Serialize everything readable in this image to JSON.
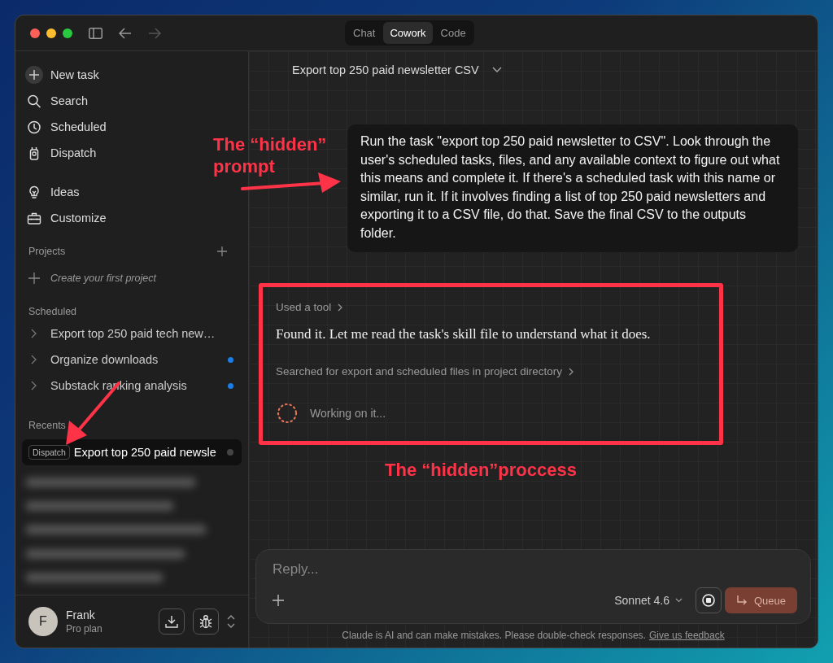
{
  "window": {
    "tabs": [
      {
        "label": "Chat",
        "selected": false
      },
      {
        "label": "Cowork",
        "selected": true
      },
      {
        "label": "Code",
        "selected": false
      }
    ]
  },
  "sidebar": {
    "nav_primary": [
      {
        "label": "New task"
      },
      {
        "label": "Search"
      },
      {
        "label": "Scheduled"
      },
      {
        "label": "Dispatch"
      }
    ],
    "nav_secondary": [
      {
        "label": "Ideas"
      },
      {
        "label": "Customize"
      }
    ],
    "projects": {
      "heading": "Projects",
      "empty_action": "Create your first project"
    },
    "scheduled": {
      "heading": "Scheduled",
      "items": [
        {
          "label": "Export top 250 paid tech new…",
          "unread": false
        },
        {
          "label": "Organize downloads",
          "unread": true
        },
        {
          "label": "Substack ranking analysis",
          "unread": true
        }
      ]
    },
    "recents": {
      "heading": "Recents",
      "items": [
        {
          "badge": "Dispatch",
          "label": "Export top 250 paid newsle",
          "selected": true
        }
      ]
    },
    "user": {
      "initial": "F",
      "name": "Frank",
      "plan": "Pro plan"
    }
  },
  "main": {
    "title": "Export top 250 paid newsletter CSV",
    "prompt": "Run the task \"export top 250 paid newsletter to CSV\". Look through the user's scheduled tasks, files, and any available context to figure out what this means and complete it. If there's a scheduled task with this name or similar, run it. If it involves finding a list of top 250 paid newsletters and exporting it to a CSV file, do that. Save the final CSV to the outputs folder.",
    "process": {
      "tool_step": "Used a tool",
      "message": "Found it. Let me read the task's skill file to understand what it does.",
      "search_step": "Searched for export and scheduled files in project directory",
      "status": "Working on it..."
    },
    "composer": {
      "placeholder": "Reply...",
      "model": "Sonnet 4.6",
      "send_label": "Queue"
    },
    "disclaimer": "Claude is AI and can make mistakes. Please double-check responses.",
    "feedback_link": "Give us feedback"
  },
  "annotations": {
    "prompt_label": "The “hidden” prompt",
    "process_label": "The “hidden”proccess"
  }
}
